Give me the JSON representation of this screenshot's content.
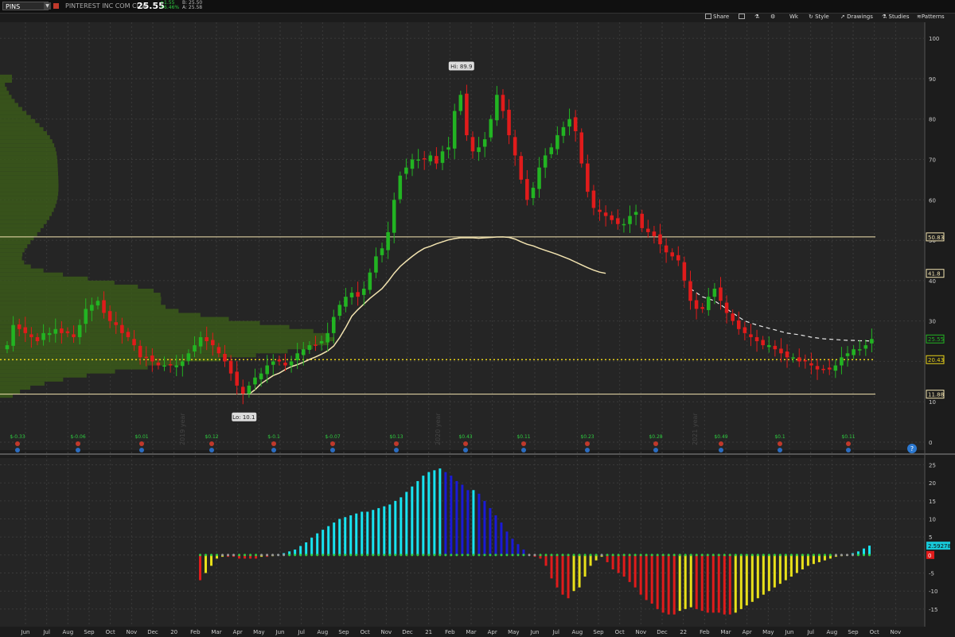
{
  "header": {
    "symbol": "PINS",
    "company": "PINTEREST INC COM CL A",
    "last": "25.55",
    "change": "+1.55",
    "change_pct": "+6.46%",
    "bid": "B: 25.50",
    "ask": "A: 25.58"
  },
  "toolbar": {
    "share": "Share",
    "aggregation": "Wk",
    "style": "Style",
    "drawings": "Drawings",
    "studies": "Studies",
    "patterns": "Patterns"
  },
  "colors": {
    "up": "#22b422",
    "down": "#e01b1b",
    "volume_profile": "#3b5a1a",
    "sma": "#f2e3b0",
    "hline": "#f2e3b0",
    "dotted": "#e8d21a",
    "hist_cyan": "#18e3f0",
    "hist_blue": "#1a1ad6",
    "hist_red": "#e01b1b",
    "hist_yellow": "#e8e01a"
  },
  "chart_data": [
    {
      "type": "candlestick",
      "title": "PINS",
      "ylim": [
        0,
        102
      ],
      "yticks": [
        0,
        10,
        20,
        30,
        40,
        50,
        60,
        70,
        80,
        90,
        100
      ],
      "x_labels": [
        "Jun",
        "Jul",
        "Aug",
        "Sep",
        "Oct",
        "Nov",
        "Dec",
        "20",
        "Feb",
        "Mar",
        "Apr",
        "May",
        "Jun",
        "Jul",
        "Aug",
        "Sep",
        "Oct",
        "Nov",
        "Dec",
        "21",
        "Feb",
        "Mar",
        "Apr",
        "May",
        "Jun",
        "Jul",
        "Aug",
        "Sep",
        "Oct",
        "Nov",
        "Dec",
        "22",
        "Feb",
        "Mar",
        "Apr",
        "May",
        "Jun",
        "Jul",
        "Aug",
        "Sep",
        "Oct",
        "Nov"
      ],
      "year_labels": [
        "2019 year",
        "2020 year",
        "2021 year"
      ],
      "price_labels": [
        {
          "text": "50.83",
          "value": 50.83,
          "color": "#f2e3b0"
        },
        {
          "text": "41.8",
          "value": 41.8,
          "color": "#f2e3b0"
        },
        {
          "text": "25.55",
          "value": 25.55,
          "color": "#22b422"
        },
        {
          "text": "20.43",
          "value": 20.43,
          "color": "#e8d21a"
        },
        {
          "text": "11.88",
          "value": 11.88,
          "color": "#f2e3b0"
        }
      ],
      "hi_label": "Hi: 89.9",
      "hi_value": 89.9,
      "lo_label": "Lo: 10.1",
      "lo_value": 10.1,
      "earnings": [
        "$-0.33",
        "$-0.06",
        "$0.01",
        "$0.12",
        "$-0.1",
        "$-0.07",
        "$0.13",
        "$0.43",
        "$0.11",
        "$0.23",
        "$0.28",
        "$0.49",
        "$0.1",
        "$0.11"
      ],
      "closes": [
        24,
        29,
        28,
        27,
        26,
        25,
        27,
        27,
        28,
        27,
        27,
        26,
        29,
        33,
        34,
        35,
        32,
        30,
        29,
        27,
        26,
        24,
        21,
        21,
        20,
        19,
        19,
        19,
        19,
        20,
        22,
        24,
        26,
        25,
        24,
        22,
        20,
        17,
        14,
        12,
        14,
        16,
        17,
        19,
        20,
        20,
        19,
        20,
        22,
        23,
        24,
        24,
        25,
        27,
        31,
        34,
        36,
        37,
        36,
        38,
        42,
        46,
        48,
        52,
        60,
        66,
        68,
        70,
        70,
        70,
        71,
        69,
        72,
        73,
        82,
        86,
        76,
        72,
        73,
        75,
        80,
        86,
        82,
        76,
        71,
        65,
        60,
        63,
        68,
        71,
        73,
        76,
        78,
        80,
        77,
        69,
        62,
        58,
        57,
        56,
        55,
        54,
        54,
        56,
        57,
        53,
        52,
        51,
        49,
        47,
        46,
        45,
        40,
        35,
        33,
        33,
        36,
        38,
        35,
        32,
        30,
        28,
        27,
        26,
        25,
        24,
        24,
        23,
        22,
        21,
        21,
        20,
        20,
        19,
        18,
        18,
        18,
        19,
        21,
        22,
        23,
        23,
        24,
        25.55
      ],
      "sma": [
        null,
        null,
        null,
        null,
        null,
        null,
        null,
        null,
        null,
        null,
        null,
        null,
        null,
        null,
        null,
        null,
        null,
        null,
        null,
        null,
        null,
        null,
        null,
        null,
        null,
        null,
        null,
        null,
        null,
        null,
        null,
        null,
        null,
        null,
        null,
        null,
        null,
        null,
        null,
        null,
        11.9,
        13.0,
        14.5,
        15.5,
        16.5,
        17.1,
        18,
        18.7,
        19.2,
        19.8,
        20.5,
        21.1,
        21.8,
        22.6,
        23.8,
        25.9,
        28.4,
        31.2,
        32.8,
        34.2,
        35.6,
        36.8,
        38,
        39.8,
        41.8,
        43.5,
        44.8,
        46,
        47.1,
        48,
        48.5,
        49.1,
        49.6,
        50.1,
        50.4,
        50.6,
        50.6,
        50.6,
        50.5,
        50.6,
        50.7,
        50.8,
        50.83,
        50.7,
        50.3,
        49.6,
        49,
        48.6,
        48,
        47.5,
        47,
        46.5,
        45.9,
        45.3,
        44.6,
        43.9,
        43.2,
        42.6,
        42.1,
        41.8
      ],
      "sma_start_index": 40,
      "dashed_ma": [
        38,
        37,
        36,
        35.5,
        35,
        34,
        33,
        32,
        31,
        30,
        29.5,
        29,
        28.6,
        28.2,
        27.8,
        27.4,
        27,
        26.8,
        26.6,
        26.3,
        26,
        25.8,
        25.6,
        25.5,
        25.4,
        25.3,
        25.2,
        25.2,
        25.1,
        25.1,
        25
      ],
      "dashed_start_index": 113,
      "levels": {
        "upper": 50.83,
        "lower": 11.88,
        "dotted": 20.43
      }
    },
    {
      "type": "histogram",
      "ylim": [
        -19,
        26
      ],
      "yticks": [
        -15,
        -10,
        -5,
        0,
        5,
        10,
        15,
        20,
        25
      ],
      "value_label": "2.59278",
      "start_index": 64,
      "values": [
        -7,
        -5,
        -3,
        -1,
        -0.5,
        -0.5,
        -0.5,
        -1,
        -1,
        -1,
        -1,
        -0.5,
        -0.5,
        -0.3,
        0.2,
        0.5,
        1,
        1.5,
        2.5,
        3.5,
        4.8,
        6,
        7,
        8,
        9,
        10,
        10.5,
        11,
        11.5,
        12,
        12,
        12.5,
        13,
        13.5,
        14,
        15,
        16,
        17.5,
        19,
        20.5,
        22,
        23,
        23.5,
        24,
        23,
        22,
        20.5,
        19.5,
        18,
        18,
        17,
        15,
        13,
        11,
        9,
        6.5,
        4.5,
        3,
        1.5,
        0,
        -0.5,
        -1,
        -3,
        -6.5,
        -9,
        -11,
        -12,
        -10,
        -9,
        -6,
        -3,
        -1.5,
        -0.5,
        -2,
        -4,
        -5,
        -6,
        -7.5,
        -9,
        -11,
        -12.5,
        -13.5,
        -15,
        -16,
        -16.5,
        -16.5,
        -15.5,
        -15,
        -14.5,
        -15,
        -15.5,
        -16,
        -16,
        -16,
        -16.5,
        -16.5,
        -16,
        -15,
        -14,
        -13,
        -12,
        -11,
        -10,
        -9,
        -8,
        -7,
        -6,
        -5,
        -4,
        -3,
        -2.5,
        -2,
        -1.5,
        -1,
        -0.5,
        -0.3,
        -0.2,
        0.5,
        1,
        1.8,
        2.59278
      ],
      "colors_sequence": "yellow for early negatives, red for later negatives, cyan rising positives, blue falling positives"
    }
  ]
}
